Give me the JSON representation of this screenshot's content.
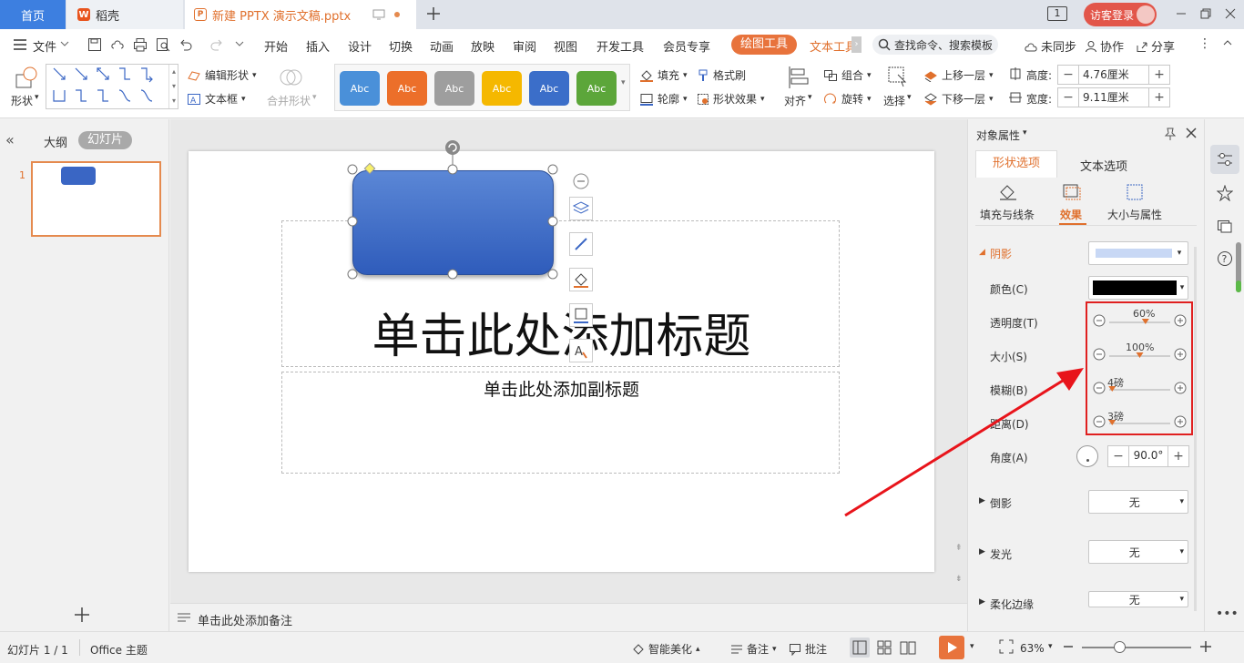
{
  "tabs": {
    "home": "首页",
    "daoke": "稻壳",
    "doc": "新建 PPTX 演示文稿.pptx",
    "page_badge": "1",
    "login": "访客登录"
  },
  "menu": {
    "file": "文件",
    "items": [
      "开始",
      "插入",
      "设计",
      "切换",
      "动画",
      "放映",
      "审阅",
      "视图",
      "开发工具",
      "会员专享"
    ],
    "drawing_tools": "绘图工具",
    "text_tools": "文本工具",
    "search": "查找命令、搜索模板",
    "unsynced": "未同步",
    "collab": "协作",
    "share": "分享"
  },
  "ribbon": {
    "shape": "形状",
    "edit_shape": "编辑形状",
    "text_box": "文本框",
    "merge_shape": "合并形状",
    "styles": [
      {
        "label": "Abc",
        "color": "#4a90d9"
      },
      {
        "label": "Abc",
        "color": "#ec6f2a"
      },
      {
        "label": "Abc",
        "color": "#9e9e9e"
      },
      {
        "label": "Abc",
        "color": "#f5b800"
      },
      {
        "label": "Abc",
        "color": "#3b6ec9"
      },
      {
        "label": "Abc",
        "color": "#5ca63a"
      }
    ],
    "fill": "填充",
    "format_brush": "格式刷",
    "outline": "轮廓",
    "shape_effect": "形状效果",
    "align": "对齐",
    "group": "组合",
    "rotate": "旋转",
    "select": "选择",
    "move_up": "上移一层",
    "move_down": "下移一层",
    "height_label": "高度:",
    "height_value": "4.76厘米",
    "width_label": "宽度:",
    "width_value": "9.11厘米"
  },
  "left": {
    "outline": "大纲",
    "slides": "幻灯片",
    "slide_num": "1"
  },
  "slide": {
    "title": "单击此处添加标题",
    "subtitle": "单击此处添加副标题",
    "notes": "单击此处添加备注"
  },
  "right": {
    "header": "对象属性",
    "tab_shape": "形状选项",
    "tab_text": "文本选项",
    "sub_fill": "填充与线条",
    "sub_effect": "效果",
    "sub_size": "大小与属性",
    "shadow": "阴影",
    "color": "颜色(C)",
    "transparency": "透明度(T)",
    "transparency_value": "60%",
    "transparency_level": 0.6,
    "size": "大小(S)",
    "size_value": "100%",
    "size_level": 0.5,
    "blur": "模糊(B)",
    "blur_value": "4磅",
    "blur_level": 0.02,
    "distance": "距离(D)",
    "distance_value": "3磅",
    "distance_level": 0.02,
    "angle": "角度(A)",
    "angle_value": "90.0°",
    "reflection": "倒影",
    "reflection_value": "无",
    "glow": "发光",
    "glow_value": "无",
    "soft_edge": "柔化边缘",
    "soft_edge_value": "无"
  },
  "status": {
    "slide_counter": "幻灯片 1 / 1",
    "theme": "Office 主题",
    "smart": "智能美化",
    "notes": "备注",
    "comments": "批注",
    "zoom": "63%"
  },
  "colors": {
    "accent": "#e8733c",
    "shape_fill": "#3a66c4",
    "highlight_box": "#e02020",
    "arrow": "#e8141b"
  }
}
